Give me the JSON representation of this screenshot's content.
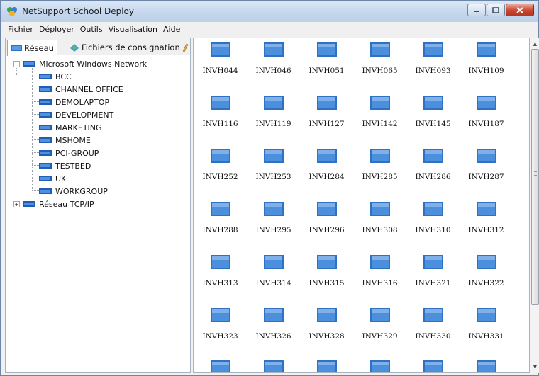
{
  "window": {
    "title": "NetSupport School Deploy"
  },
  "menu": [
    "Fichier",
    "Déployer",
    "Outils",
    "Visualisation",
    "Aide"
  ],
  "tabs": {
    "network": "Réseau",
    "logs": "Fichiers de consignation"
  },
  "tree": {
    "root": "Microsoft Windows Network",
    "workgroups": [
      "BCC",
      "CHANNEL OFFICE",
      "DEMOLAPTOP",
      "DEVELOPMENT",
      "MARKETING",
      "MSHOME",
      "PCI-GROUP",
      "TESTBED",
      "UK",
      "WORKGROUP"
    ],
    "tcpip": "Réseau TCP/IP"
  },
  "computers": [
    "INVH044",
    "INVH046",
    "INVH051",
    "INVH065",
    "INVH093",
    "INVH109",
    "INVH116",
    "INVH119",
    "INVH127",
    "INVH142",
    "INVH145",
    "INVH187",
    "INVH252",
    "INVH253",
    "INVH284",
    "INVH285",
    "INVH286",
    "INVH287",
    "INVH288",
    "INVH295",
    "INVH296",
    "INVH308",
    "INVH310",
    "INVH312",
    "INVH313",
    "INVH314",
    "INVH315",
    "INVH316",
    "INVH321",
    "INVH322",
    "INVH323",
    "INVH326",
    "INVH328",
    "INVH329",
    "INVH330",
    "INVH331"
  ],
  "colors": {
    "titlebar": "#c4d6ec",
    "icon_blue": "#2f72c4",
    "close": "#c8472f"
  }
}
